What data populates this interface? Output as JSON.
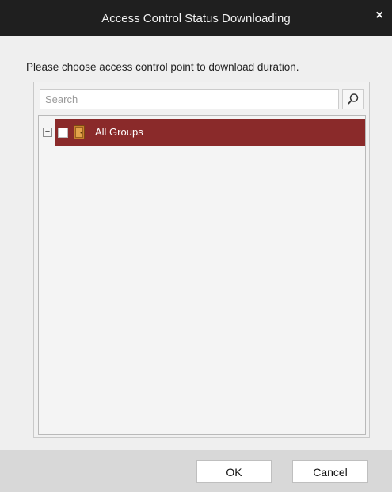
{
  "window": {
    "title": "Access Control Status Downloading",
    "close_label": "×"
  },
  "instruction": "Please choose access control point to download duration.",
  "search": {
    "placeholder": "Search",
    "value": ""
  },
  "tree": {
    "items": [
      {
        "label": "All Groups",
        "expander": "−",
        "expanded": true,
        "checked": false,
        "selected": true
      }
    ]
  },
  "buttons": {
    "ok_label": "OK",
    "cancel_label": "Cancel"
  },
  "colors": {
    "selection": "#8a2a2a",
    "titlebar": "#1f1f1f"
  },
  "icons": {
    "search": "search-icon",
    "group": "door-group-icon",
    "close": "close-icon"
  }
}
